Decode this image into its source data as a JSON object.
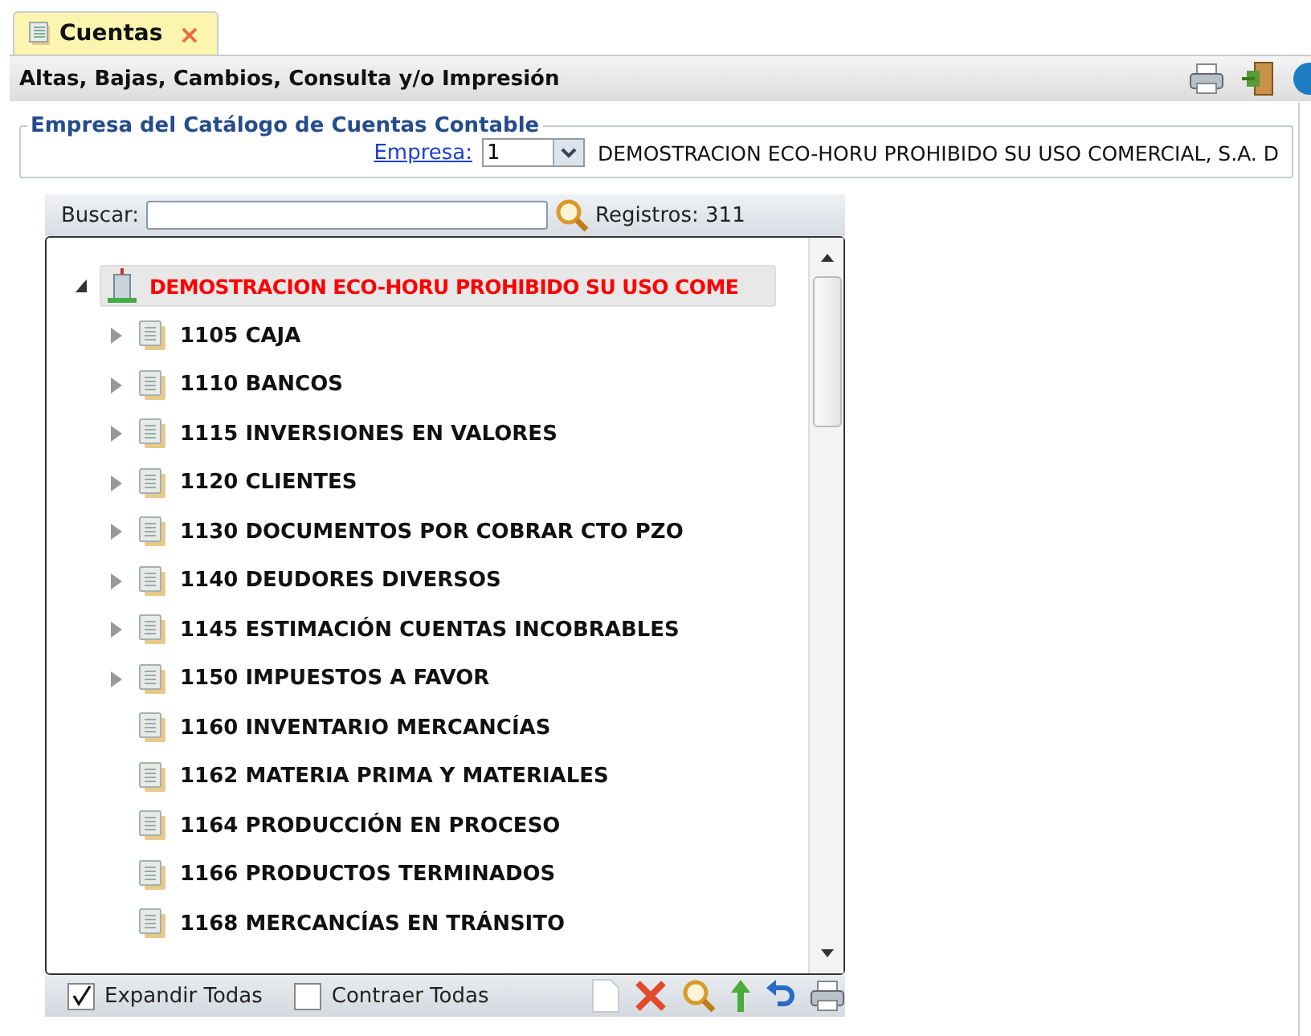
{
  "tab": {
    "label": "Cuentas",
    "close": "×"
  },
  "toolbar": {
    "title": "Altas, Bajas, Cambios, Consulta y/o Impresión"
  },
  "company_section": {
    "legend": "Empresa del Catálogo de Cuentas Contable",
    "label": "Empresa:",
    "select_value": "1",
    "company_name": "DEMOSTRACION ECO-HORU PROHIBIDO SU USO COMERCIAL, S.A. D"
  },
  "search": {
    "label": "Buscar:",
    "count": "Registros: 311"
  },
  "tree": {
    "root": {
      "label": "DEMOSTRACION ECO-HORU PROHIBIDO SU USO COME",
      "expanded": true,
      "selected": true,
      "children": [
        {
          "label": "1105 CAJA",
          "kind": "branch"
        },
        {
          "label": "1110 BANCOS",
          "kind": "branch"
        },
        {
          "label": "1115 INVERSIONES EN VALORES",
          "kind": "branch"
        },
        {
          "label": "1120 CLIENTES",
          "kind": "branch"
        },
        {
          "label": "1130 DOCUMENTOS POR COBRAR CTO PZO",
          "kind": "branch"
        },
        {
          "label": "1140 DEUDORES DIVERSOS",
          "kind": "branch"
        },
        {
          "label": "1145 ESTIMACIÓN CUENTAS INCOBRABLES",
          "kind": "branch"
        },
        {
          "label": "1150 IMPUESTOS A FAVOR",
          "kind": "branch"
        },
        {
          "label": "1160 INVENTARIO MERCANCÍAS",
          "kind": "leaf"
        },
        {
          "label": "1162 MATERIA PRIMA Y MATERIALES",
          "kind": "leaf"
        },
        {
          "label": "1164 PRODUCCIÓN EN PROCESO",
          "kind": "leaf"
        },
        {
          "label": "1166 PRODUCTOS TERMINADOS",
          "kind": "leaf"
        },
        {
          "label": "1168 MERCANCÍAS EN TRÁNSITO",
          "kind": "leaf"
        }
      ]
    }
  },
  "options": [
    {
      "label": "Expandir Todas",
      "checked": true
    },
    {
      "label": "Contraer Todas",
      "checked": false
    }
  ]
}
